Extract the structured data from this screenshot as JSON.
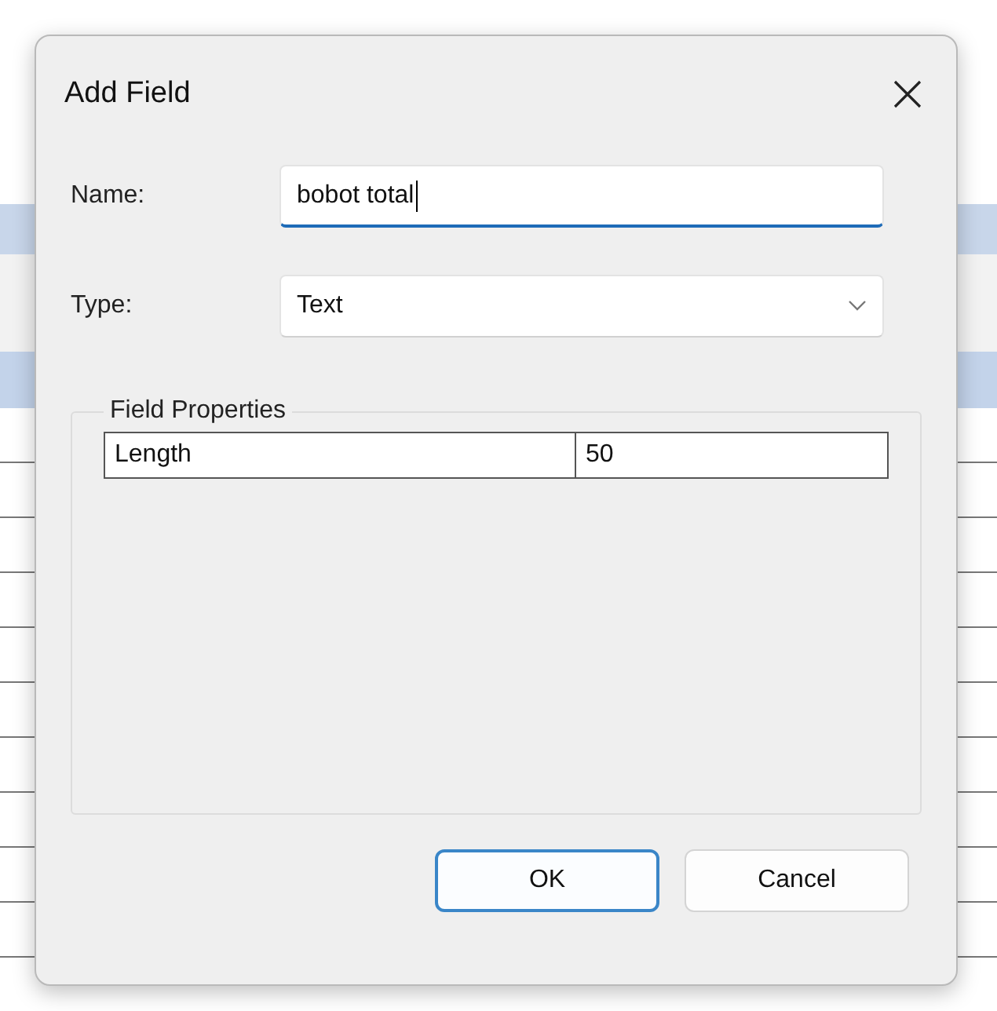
{
  "dialog": {
    "title": "Add Field",
    "fields": [
      {
        "kind": "text",
        "label": "Name:",
        "value": "bobot total",
        "focused": true
      },
      {
        "kind": "dropdown",
        "label": "Type:",
        "value": "Text",
        "focused": false
      }
    ],
    "group": {
      "title": "Field Properties",
      "properties": [
        {
          "name": "Length",
          "value": "50"
        }
      ]
    },
    "buttons": [
      {
        "label": "OK",
        "default": true
      },
      {
        "label": "Cancel",
        "default": false
      }
    ]
  }
}
